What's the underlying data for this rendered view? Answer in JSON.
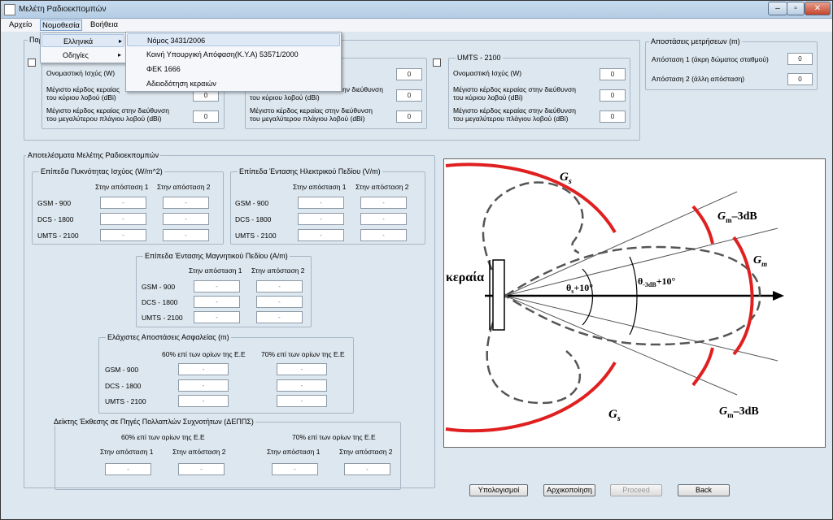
{
  "window": {
    "title": "Μελέτη Ραδιοεκπομπών",
    "controls": [
      "–",
      "▫",
      "✕"
    ]
  },
  "menubar": [
    "Αρχείο",
    "Νομοθεσία",
    "Βοήθεια"
  ],
  "menu_primary": [
    {
      "label": "Ελληνικά",
      "arrow": "▸"
    },
    {
      "label": "Οδηγίες",
      "arrow": "▸"
    }
  ],
  "menu_submenu": [
    "Νόμος 3431/2006",
    "Κοινή Υπουργική Απόφαση(Κ.Υ.Α) 53571/2000",
    "ΦΕΚ 1666",
    "Αδειοδότηση κεραιών"
  ],
  "params": {
    "group_title_fragment": "Παρ",
    "col1": {
      "power_label": "Ονομαστική Ισχύς (W)",
      "main_gain_label_1": "Μέγιστο κέρδος κεραίας",
      "main_gain_label_2": "του κύριου λοβού (dBi)",
      "main_gain_value": "0",
      "side_gain_label_1": "Μέγιστο κέρδος κεραίας στην διεύθυνση",
      "side_gain_label_2": "του μεγαλύτερου πλάγιου λοβού (dBi)",
      "side_gain_value": "0"
    },
    "col2": {
      "power_value": "0",
      "main_gain_label_1": "ην διεύθυνση",
      "main_gain_label_2": "του κύριου λοβού (dBi)",
      "main_gain_value": "0",
      "side_gain_label_1": "Μέγιστο κέρδος κεραίας στην διεύθυνση",
      "side_gain_label_2": "του μεγαλύτερου πλάγιου λοβού (dBi)",
      "side_gain_value": "0"
    },
    "col3": {
      "title": "UMTS - 2100",
      "power_label": "Ονομαστική Ισχύς (W)",
      "power_value": "0",
      "main_gain_label_1": "Μέγιστο κέρδος κεραίας στην διεύθυνση",
      "main_gain_label_2": "του κύριου λοβού (dBi)",
      "main_gain_value": "0",
      "side_gain_label_1": "Μέγιστο κέρδος κεραίας στην διεύθυνση",
      "side_gain_label_2": "του μεγαλύτερου πλάγιου λοβού (dBi)",
      "side_gain_value": "0"
    }
  },
  "distances": {
    "title": "Αποστάσεις μετρήσεων (m)",
    "d1_label": "Απόσταση 1 (άκρη δώματος σταθμού)",
    "d1_value": "0",
    "d2_label": "Απόσταση 2 (άλλη απόσταση)",
    "d2_value": "0"
  },
  "results": {
    "title": "Αποτελέσματα Μελέτης Ραδιοεκπομπών",
    "placeholder": "-",
    "power_density": {
      "title": "Επίπεδα Πυκνότητας Ισχύος (W/m^2)",
      "col1": "Στην απόσταση 1",
      "col2": "Στην απόσταση 2",
      "rows": [
        "GSM - 900",
        "DCS - 1800",
        "UMTS - 2100"
      ]
    },
    "efield": {
      "title": "Επίπεδα Έντασης Ηλεκτρικού Πεδίου (V/m)",
      "col1": "Στην απόσταση 1",
      "col2": "Στην απόσταση 2",
      "rows": [
        "GSM - 900",
        "DCS - 1800",
        "UMTS - 2100"
      ]
    },
    "hfield": {
      "title": "Επίπεδα Έντασης Μαγνητικού Πεδίου (A/m)",
      "col1": "Στην απόσταση 1",
      "col2": "Στην απόσταση 2",
      "rows": [
        "GSM - 900",
        "DCS - 1800",
        "UMTS - 2100"
      ]
    },
    "safety": {
      "title": "Ελάχιστες Αποστάσεις Ασφαλείας (m)",
      "col1": "60% επί των ορίων της Ε.Ε",
      "col2": "70% επί των ορίων της Ε.Ε",
      "rows": [
        "GSM - 900",
        "DCS - 1800",
        "UMTS - 2100"
      ]
    },
    "multi": {
      "title": "Δείκτης Έκθεσης σε Πηγές Πολλαπλών Συχνοτήτων (ΔΕΠΠΣ)",
      "h60": "60% επί των ορίων της Ε.Ε",
      "h70": "70% επί των ορίων της Ε.Ε",
      "c1": "Στην απόσταση 1",
      "c2": "Στην απόσταση 2",
      "c3": "Στην απόσταση 1",
      "c4": "Στην απόσταση 2"
    }
  },
  "diagram": {
    "antenna_label": "κεραία",
    "gs_label": "G",
    "gs_sub": "s",
    "gm_label": "G",
    "gm_sub": "m",
    "gm3_suffix": "–3dB",
    "angle1_text": "θ",
    "angle1_sub": "s",
    "angle1_suffix": "+10°",
    "angle2_text": "θ",
    "angle2_sub": "-3dB",
    "angle2_suffix": "+10°",
    "red": "#e02020"
  },
  "buttons": {
    "calculate": "Υπολογισμοί",
    "reset": "Αρχικοποίηση",
    "proceed": "Proceed",
    "back": "Back"
  }
}
